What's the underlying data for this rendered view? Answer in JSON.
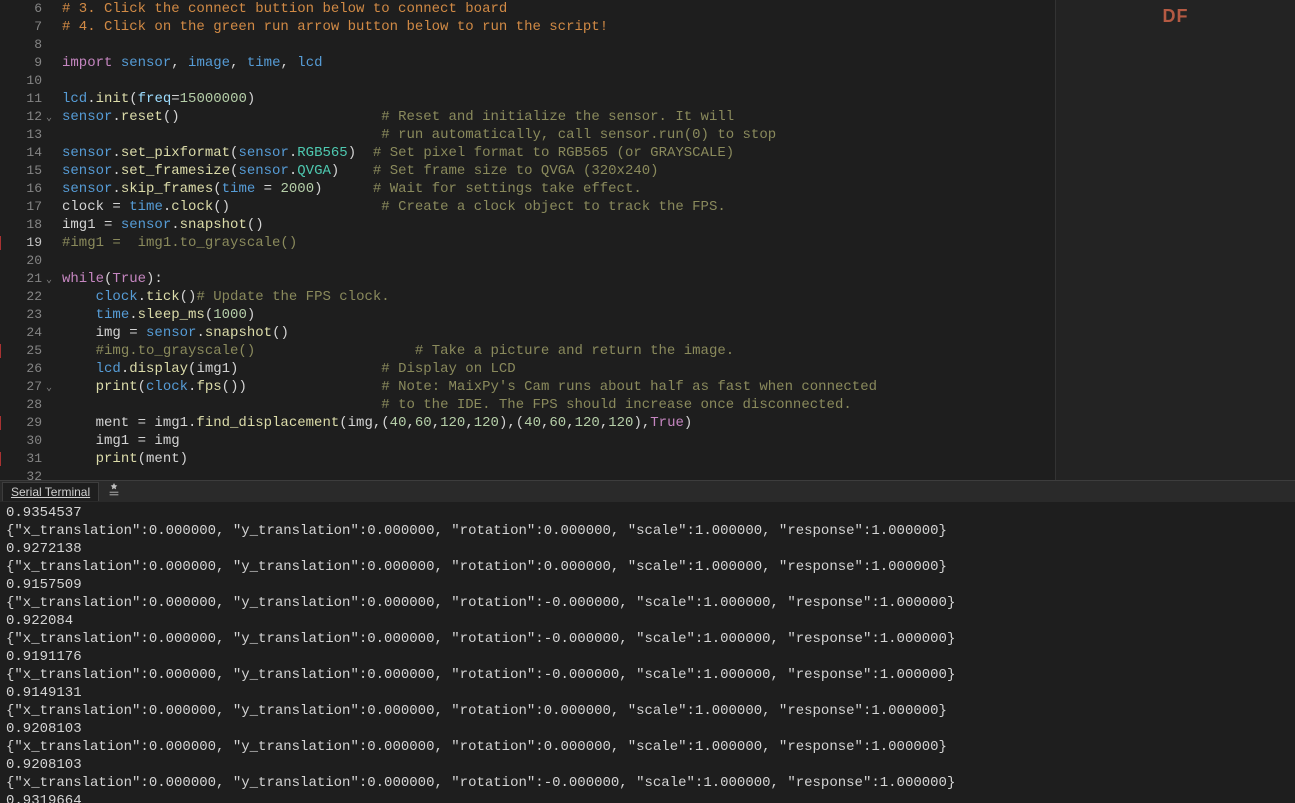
{
  "side": {
    "badge": "DF"
  },
  "term": {
    "tab_label": "Serial Terminal"
  },
  "code": {
    "lines": [
      {
        "n": 6,
        "tokens": [
          {
            "t": "# 3. Click the connect buttion below to connect board",
            "c": "c-com2"
          }
        ]
      },
      {
        "n": 7,
        "tokens": [
          {
            "t": "# 4. Click on the green run arrow button below to run the script!",
            "c": "c-com2"
          }
        ]
      },
      {
        "n": 8,
        "tokens": []
      },
      {
        "n": 9,
        "tokens": [
          {
            "t": "import ",
            "c": "c-kw"
          },
          {
            "t": "sensor",
            "c": "c-id"
          },
          {
            "t": ", ",
            "c": "c-pun"
          },
          {
            "t": "image",
            "c": "c-id"
          },
          {
            "t": ", ",
            "c": "c-pun"
          },
          {
            "t": "time",
            "c": "c-id"
          },
          {
            "t": ", ",
            "c": "c-pun"
          },
          {
            "t": "lcd",
            "c": "c-id"
          }
        ]
      },
      {
        "n": 10,
        "tokens": []
      },
      {
        "n": 11,
        "tokens": [
          {
            "t": "lcd",
            "c": "c-id"
          },
          {
            "t": ".",
            "c": "c-pun"
          },
          {
            "t": "init",
            "c": "c-fn"
          },
          {
            "t": "(",
            "c": "c-pun"
          },
          {
            "t": "freq",
            "c": "c-kwarg"
          },
          {
            "t": "=",
            "c": "c-pun"
          },
          {
            "t": "15000000",
            "c": "c-num"
          },
          {
            "t": ")",
            "c": "c-pun"
          }
        ]
      },
      {
        "n": 12,
        "fold": true,
        "tokens": [
          {
            "t": "sensor",
            "c": "c-id"
          },
          {
            "t": ".",
            "c": "c-pun"
          },
          {
            "t": "reset",
            "c": "c-fn"
          },
          {
            "t": "()",
            "c": "c-pun"
          },
          {
            "t": "                        ",
            "c": "c-pun"
          },
          {
            "t": "# Reset and initialize the sensor. It will",
            "c": "c-com"
          }
        ]
      },
      {
        "n": 13,
        "tokens": [
          {
            "t": "                                      ",
            "c": "c-pun"
          },
          {
            "t": "# run automatically, call sensor.run(0) to stop",
            "c": "c-com"
          }
        ]
      },
      {
        "n": 14,
        "tokens": [
          {
            "t": "sensor",
            "c": "c-id"
          },
          {
            "t": ".",
            "c": "c-pun"
          },
          {
            "t": "set_pixformat",
            "c": "c-fn"
          },
          {
            "t": "(",
            "c": "c-pun"
          },
          {
            "t": "sensor",
            "c": "c-id"
          },
          {
            "t": ".",
            "c": "c-pun"
          },
          {
            "t": "RGB565",
            "c": "c-mem"
          },
          {
            "t": ")  ",
            "c": "c-pun"
          },
          {
            "t": "# Set pixel format to RGB565 (or GRAYSCALE)",
            "c": "c-com"
          }
        ]
      },
      {
        "n": 15,
        "tokens": [
          {
            "t": "sensor",
            "c": "c-id"
          },
          {
            "t": ".",
            "c": "c-pun"
          },
          {
            "t": "set_framesize",
            "c": "c-fn"
          },
          {
            "t": "(",
            "c": "c-pun"
          },
          {
            "t": "sensor",
            "c": "c-id"
          },
          {
            "t": ".",
            "c": "c-pun"
          },
          {
            "t": "QVGA",
            "c": "c-mem"
          },
          {
            "t": ")    ",
            "c": "c-pun"
          },
          {
            "t": "# Set frame size to QVGA (320x240)",
            "c": "c-com"
          }
        ]
      },
      {
        "n": 16,
        "tokens": [
          {
            "t": "sensor",
            "c": "c-id"
          },
          {
            "t": ".",
            "c": "c-pun"
          },
          {
            "t": "skip_frames",
            "c": "c-fn"
          },
          {
            "t": "(",
            "c": "c-pun"
          },
          {
            "t": "time",
            "c": "c-id"
          },
          {
            "t": " = ",
            "c": "c-pun"
          },
          {
            "t": "2000",
            "c": "c-num"
          },
          {
            "t": ")      ",
            "c": "c-pun"
          },
          {
            "t": "# Wait for settings take effect.",
            "c": "c-com"
          }
        ]
      },
      {
        "n": 17,
        "tokens": [
          {
            "t": "clock",
            "c": "c-pun"
          },
          {
            "t": " = ",
            "c": "c-pun"
          },
          {
            "t": "time",
            "c": "c-id"
          },
          {
            "t": ".",
            "c": "c-pun"
          },
          {
            "t": "clock",
            "c": "c-fn"
          },
          {
            "t": "()                  ",
            "c": "c-pun"
          },
          {
            "t": "# Create a clock object to track the FPS.",
            "c": "c-com"
          }
        ]
      },
      {
        "n": 18,
        "tokens": [
          {
            "t": "img1 = ",
            "c": "c-pun"
          },
          {
            "t": "sensor",
            "c": "c-id"
          },
          {
            "t": ".",
            "c": "c-pun"
          },
          {
            "t": "snapshot",
            "c": "c-fn"
          },
          {
            "t": "()",
            "c": "c-pun"
          }
        ]
      },
      {
        "n": 19,
        "cur": true,
        "bp": true,
        "tokens": [
          {
            "t": "#img1 =  img1.to_grayscale()",
            "c": "c-com"
          }
        ]
      },
      {
        "n": 20,
        "tokens": []
      },
      {
        "n": 21,
        "fold": true,
        "tokens": [
          {
            "t": "while",
            "c": "c-kw"
          },
          {
            "t": "(",
            "c": "c-pun"
          },
          {
            "t": "True",
            "c": "c-const"
          },
          {
            "t": "):",
            "c": "c-pun"
          }
        ]
      },
      {
        "n": 22,
        "tokens": [
          {
            "t": "    ",
            "c": "c-pun"
          },
          {
            "t": "clock",
            "c": "c-id"
          },
          {
            "t": ".",
            "c": "c-pun"
          },
          {
            "t": "tick",
            "c": "c-fn"
          },
          {
            "t": "()",
            "c": "c-pun"
          },
          {
            "t": "# Update the FPS clock.",
            "c": "c-com"
          }
        ]
      },
      {
        "n": 23,
        "tokens": [
          {
            "t": "    ",
            "c": "c-pun"
          },
          {
            "t": "time",
            "c": "c-id"
          },
          {
            "t": ".",
            "c": "c-pun"
          },
          {
            "t": "sleep_ms",
            "c": "c-fn"
          },
          {
            "t": "(",
            "c": "c-pun"
          },
          {
            "t": "1000",
            "c": "c-num"
          },
          {
            "t": ")",
            "c": "c-pun"
          }
        ]
      },
      {
        "n": 24,
        "tokens": [
          {
            "t": "    img = ",
            "c": "c-pun"
          },
          {
            "t": "sensor",
            "c": "c-id"
          },
          {
            "t": ".",
            "c": "c-pun"
          },
          {
            "t": "snapshot",
            "c": "c-fn"
          },
          {
            "t": "()",
            "c": "c-pun"
          }
        ]
      },
      {
        "n": 25,
        "bp": true,
        "tokens": [
          {
            "t": "    ",
            "c": "c-pun"
          },
          {
            "t": "#img.to_grayscale()",
            "c": "c-com"
          },
          {
            "t": "                   ",
            "c": "c-pun"
          },
          {
            "t": "# Take a picture and return the image.",
            "c": "c-com"
          }
        ]
      },
      {
        "n": 26,
        "tokens": [
          {
            "t": "    ",
            "c": "c-pun"
          },
          {
            "t": "lcd",
            "c": "c-id"
          },
          {
            "t": ".",
            "c": "c-pun"
          },
          {
            "t": "display",
            "c": "c-fn"
          },
          {
            "t": "(img1)                 ",
            "c": "c-pun"
          },
          {
            "t": "# Display on LCD",
            "c": "c-com"
          }
        ]
      },
      {
        "n": 27,
        "fold": true,
        "tokens": [
          {
            "t": "    ",
            "c": "c-pun"
          },
          {
            "t": "print",
            "c": "c-fn"
          },
          {
            "t": "(",
            "c": "c-pun"
          },
          {
            "t": "clock",
            "c": "c-id"
          },
          {
            "t": ".",
            "c": "c-pun"
          },
          {
            "t": "fps",
            "c": "c-fn"
          },
          {
            "t": "())                ",
            "c": "c-pun"
          },
          {
            "t": "# Note: MaixPy's Cam runs about half as fast when connected",
            "c": "c-com"
          }
        ]
      },
      {
        "n": 28,
        "tokens": [
          {
            "t": "                                      ",
            "c": "c-pun"
          },
          {
            "t": "# to the IDE. The FPS should increase once disconnected.",
            "c": "c-com"
          }
        ]
      },
      {
        "n": 29,
        "bp": true,
        "tokens": [
          {
            "t": "    ment = img1.",
            "c": "c-pun"
          },
          {
            "t": "find_displacement",
            "c": "c-fn"
          },
          {
            "t": "(img,(",
            "c": "c-pun"
          },
          {
            "t": "40",
            "c": "c-num"
          },
          {
            "t": ",",
            "c": "c-pun"
          },
          {
            "t": "60",
            "c": "c-num"
          },
          {
            "t": ",",
            "c": "c-pun"
          },
          {
            "t": "120",
            "c": "c-num"
          },
          {
            "t": ",",
            "c": "c-pun"
          },
          {
            "t": "120",
            "c": "c-num"
          },
          {
            "t": "),(",
            "c": "c-pun"
          },
          {
            "t": "40",
            "c": "c-num"
          },
          {
            "t": ",",
            "c": "c-pun"
          },
          {
            "t": "60",
            "c": "c-num"
          },
          {
            "t": ",",
            "c": "c-pun"
          },
          {
            "t": "120",
            "c": "c-num"
          },
          {
            "t": ",",
            "c": "c-pun"
          },
          {
            "t": "120",
            "c": "c-num"
          },
          {
            "t": "),",
            "c": "c-pun"
          },
          {
            "t": "True",
            "c": "c-const"
          },
          {
            "t": ")",
            "c": "c-pun"
          }
        ]
      },
      {
        "n": 30,
        "tokens": [
          {
            "t": "    img1 = img",
            "c": "c-pun"
          }
        ]
      },
      {
        "n": 31,
        "bp": true,
        "tokens": [
          {
            "t": "    ",
            "c": "c-pun"
          },
          {
            "t": "print",
            "c": "c-fn"
          },
          {
            "t": "(ment)",
            "c": "c-pun"
          }
        ]
      },
      {
        "n": 32,
        "tokens": []
      }
    ]
  },
  "terminal_lines": [
    "0.9354537",
    "{\"x_translation\":0.000000, \"y_translation\":0.000000, \"rotation\":0.000000, \"scale\":1.000000, \"response\":1.000000}",
    "0.9272138",
    "{\"x_translation\":0.000000, \"y_translation\":0.000000, \"rotation\":0.000000, \"scale\":1.000000, \"response\":1.000000}",
    "0.9157509",
    "{\"x_translation\":0.000000, \"y_translation\":0.000000, \"rotation\":-0.000000, \"scale\":1.000000, \"response\":1.000000}",
    "0.922084",
    "{\"x_translation\":0.000000, \"y_translation\":0.000000, \"rotation\":-0.000000, \"scale\":1.000000, \"response\":1.000000}",
    "0.9191176",
    "{\"x_translation\":0.000000, \"y_translation\":0.000000, \"rotation\":-0.000000, \"scale\":1.000000, \"response\":1.000000}",
    "0.9149131",
    "{\"x_translation\":0.000000, \"y_translation\":0.000000, \"rotation\":0.000000, \"scale\":1.000000, \"response\":1.000000}",
    "0.9208103",
    "{\"x_translation\":0.000000, \"y_translation\":0.000000, \"rotation\":0.000000, \"scale\":1.000000, \"response\":1.000000}",
    "0.9208103",
    "{\"x_translation\":0.000000, \"y_translation\":0.000000, \"rotation\":-0.000000, \"scale\":1.000000, \"response\":1.000000}",
    "0.9319664"
  ]
}
